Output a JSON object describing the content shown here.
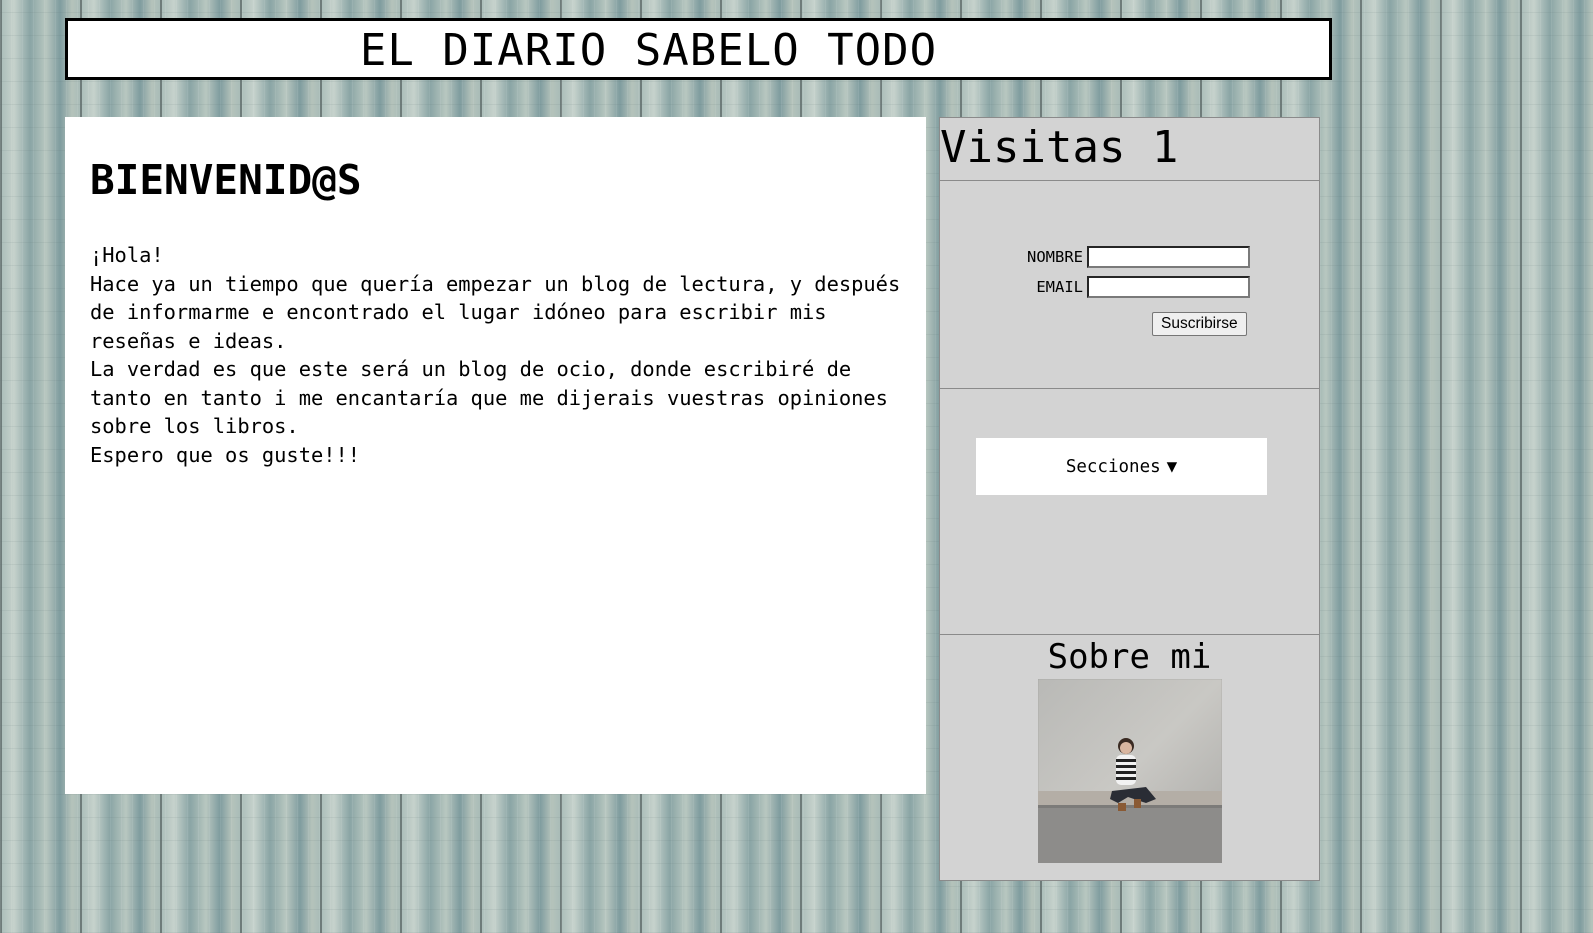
{
  "header": {
    "title": "EL DIARIO SABELO TODO"
  },
  "article": {
    "title": "BIENVENID@S",
    "paragraphs": [
      "¡Hola!",
      "Hace ya un tiempo que quería empezar un blog de lectura, y después de informarme e encontrado el lugar idóneo para escribir mis reseñas e ideas.",
      "La verdad es que este será un blog de ocio, donde escribiré de tanto en tanto i me encantaría que me dijerais vuestras opiniones sobre los libros.",
      "Espero que os guste!!!"
    ]
  },
  "sidebar": {
    "visits_label": "Visitas 1",
    "subscribe": {
      "name_label": "NOMBRE",
      "name_value": "",
      "email_label": "EMAIL",
      "email_value": "",
      "submit_label": "Suscribirse"
    },
    "sections": {
      "label": "Secciones",
      "arrow": "▼"
    },
    "about": {
      "title": "Sobre mi",
      "photo_icon": "profile-photo"
    }
  }
}
